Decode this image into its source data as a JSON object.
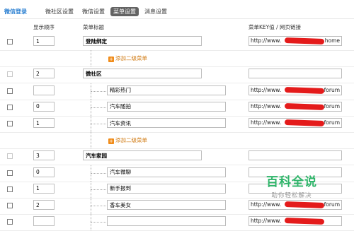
{
  "nav": {
    "brand": "微信登录",
    "tabs": [
      "微社区设置",
      "微信设置",
      "菜单设置",
      "消息设置"
    ],
    "active_tab_index": 2
  },
  "columns": {
    "order": "显示顺序",
    "name": "菜单标题",
    "url": "菜单KEY值 / 网页链接"
  },
  "add_submenu_label": "添加二级菜单",
  "rows": [
    {
      "kind": "parent",
      "checkbox_enabled": true,
      "order": "1",
      "name": "登陆绑定",
      "url": "http://www.",
      "url_end": "home",
      "redacted": true
    },
    {
      "kind": "add"
    },
    {
      "kind": "parent",
      "checkbox_enabled": false,
      "order": "2",
      "name": "微社区",
      "url": "",
      "url_end": "",
      "redacted": false
    },
    {
      "kind": "child",
      "checkbox_enabled": true,
      "order": "",
      "name": "精彩热门",
      "url": "http://www.",
      "url_end": "forum",
      "redacted": true
    },
    {
      "kind": "child",
      "checkbox_enabled": true,
      "order": "0",
      "name": "汽车随拍",
      "url": "http://www.",
      "url_end": "forum",
      "redacted": true
    },
    {
      "kind": "child",
      "checkbox_enabled": true,
      "order": "1",
      "name": "汽车资讯",
      "url": "http://www.",
      "url_end": "forum",
      "redacted": true
    },
    {
      "kind": "add"
    },
    {
      "kind": "parent",
      "checkbox_enabled": false,
      "order": "3",
      "name": "汽车家园",
      "url": "",
      "url_end": "",
      "redacted": false
    },
    {
      "kind": "child",
      "checkbox_enabled": true,
      "order": "0",
      "name": "汽车微聊",
      "url": "",
      "url_end": "",
      "redacted": false
    },
    {
      "kind": "child",
      "checkbox_enabled": true,
      "order": "1",
      "name": "新手报到",
      "url": "",
      "url_end": "",
      "redacted": false
    },
    {
      "kind": "child",
      "checkbox_enabled": true,
      "order": "2",
      "name": "香车美女",
      "url": "http://www.",
      "url_end": "forum",
      "redacted": true
    },
    {
      "kind": "child",
      "checkbox_enabled": true,
      "order": "",
      "name": "",
      "url": "http://www.",
      "url_end": "",
      "redacted": true
    }
  ],
  "watermark": {
    "title": "百科全说",
    "subtitle": "助你轻松解决"
  },
  "colors": {
    "brand": "#2a7fd1",
    "active_tab_bg": "#636363",
    "add_link": "#d07a12",
    "redaction": "#e41b1b",
    "watermark": "#2fb56a"
  }
}
